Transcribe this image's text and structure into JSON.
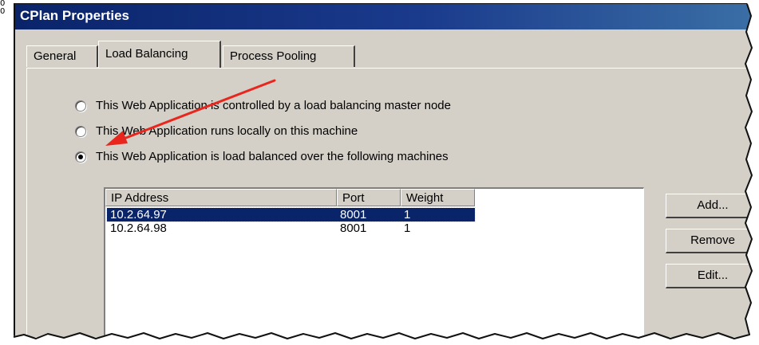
{
  "edge_labels": [
    "0",
    "0"
  ],
  "dialog": {
    "title": "CPlan Properties"
  },
  "tabs": [
    {
      "label": "General",
      "active": false
    },
    {
      "label": "Load Balancing",
      "active": true
    },
    {
      "label": "Process Pooling",
      "active": false
    }
  ],
  "radios": [
    {
      "label": "This Web Application is controlled by a load balancing master node",
      "checked": false
    },
    {
      "label": "This Web Application runs locally on this machine",
      "checked": false
    },
    {
      "label": "This Web Application is load balanced over the following machines",
      "checked": true
    }
  ],
  "machine_list": {
    "columns": [
      "IP Address",
      "Port",
      "Weight"
    ],
    "rows": [
      {
        "ip": "10.2.64.97",
        "port": "8001",
        "weight": "1",
        "selected": true
      },
      {
        "ip": "10.2.64.98",
        "port": "8001",
        "weight": "1",
        "selected": false
      }
    ]
  },
  "buttons": {
    "add": "Add...",
    "remove": "Remove",
    "edit": "Edit..."
  },
  "annotation": {
    "type": "red-arrow",
    "color": "#e8261e"
  },
  "colors": {
    "titlebar": "#0a246a",
    "dialog_face": "#d4d0c8",
    "selection": "#0a246a"
  }
}
